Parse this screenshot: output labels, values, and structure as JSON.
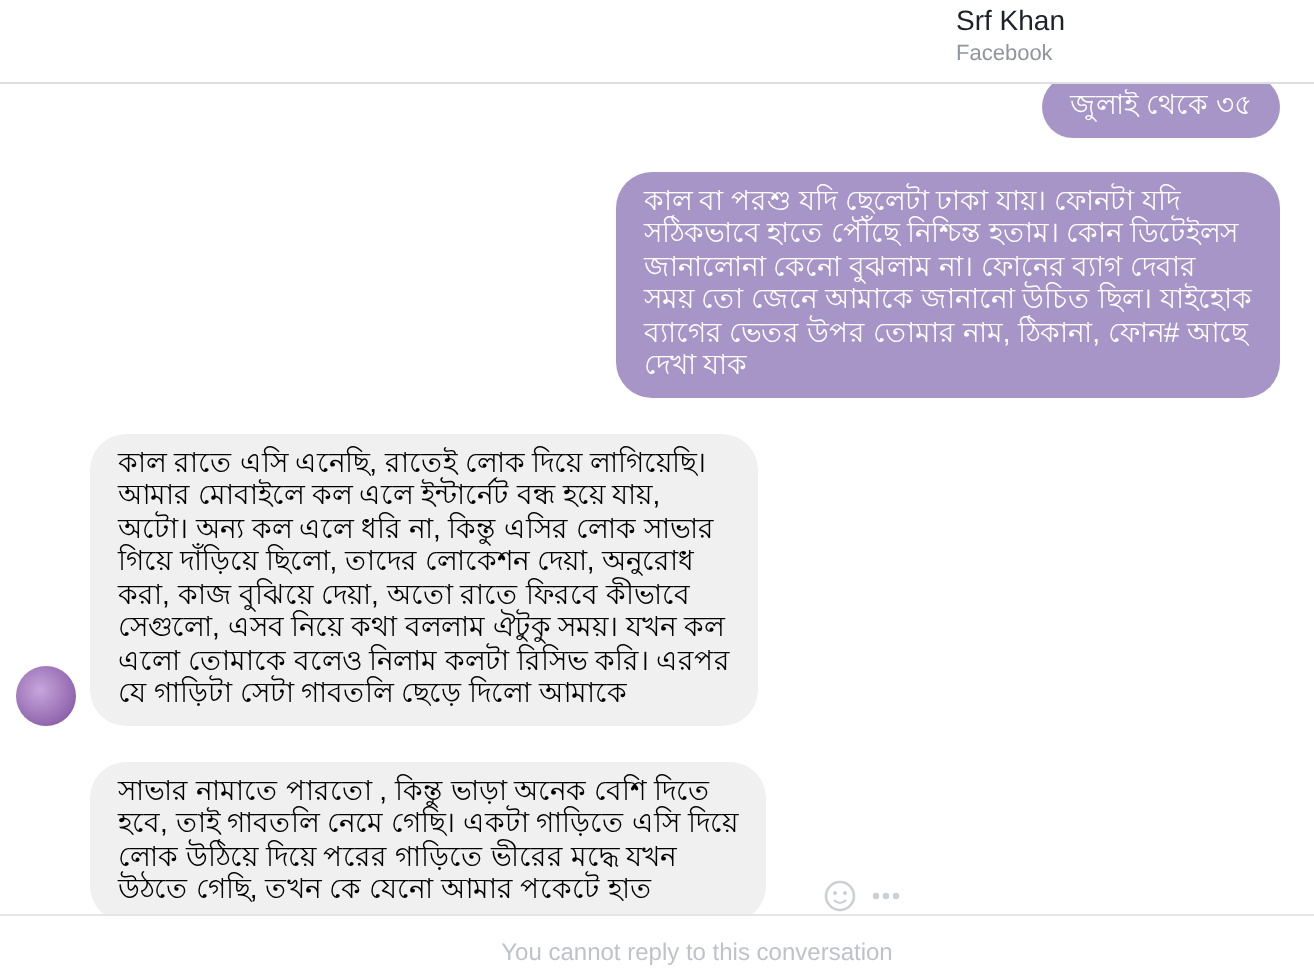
{
  "header": {
    "name": "Srf Khan",
    "subtitle": "Facebook"
  },
  "messages": [
    {
      "kind": "sent",
      "text": "জুলাই থেকে ৩৫"
    },
    {
      "kind": "sent",
      "text": "কাল বা পরশু যদি ছেলেটা ঢাকা যায়। ফোনটা যদি\nসঠিকভাবে হাতে পৌঁছে নিশ্চিন্ত হতাম। কোন ডিটেইলস\nজানালোনা কেনো বুঝলাম না।  ফোনের ব্যাগ দেবার\nসময় তো জেনে আমাকে জানানো উচিত ছিল। যাইহোক\nব্যাগের ভেতর উপর তোমার নাম, ঠিকানা, ফোন# আছে\nদেখা যাক"
    },
    {
      "kind": "received",
      "show_avatar": true,
      "text": "কাল রাতে এসি এনেছি, রাতেই লোক দিয়ে লাগিয়েছি।\nআমার মোবাইলে কল এলে ইন্টার্নেট বন্ধ হয়ে যায়,\nঅটো। অন্য কল এলে ধরি না, কিন্তু এসির লোক সাভার\nগিয়ে দাঁড়িয়ে ছিলো, তাদের লোকেশন দেয়া, অনুরোধ\nকরা, কাজ বুঝিয়ে দেয়া, অতো রাতে ফিরবে কীভাবে\nসেগুলো, এসব নিয়ে কথা বললাম ঐটুকু সময়। যখন কল\nএলো তোমাকে বলেও নিলাম কলটা রিসিভ করি। এরপর\nযে গাড়িটা সেটা গাবতলি ছেড়ে দিলো আমাকে"
    },
    {
      "kind": "received",
      "show_avatar": false,
      "text": "সাভার নামাতে পারতো , কিন্তু ভাড়া অনেক বেশি দিতে\nহবে, তাই গাবতলি নেমে গেছি। একটা গাড়িতে এসি দিয়ে\nলোক উঠিয়ে দিয়ে পরের গাড়িতে ভীরের মদ্ধে যখন\nউঠতে গেছি, তখন কে যেনো আমার পকেটে হাত"
    }
  ],
  "footer": {
    "notice": "You cannot reply to this conversation"
  }
}
